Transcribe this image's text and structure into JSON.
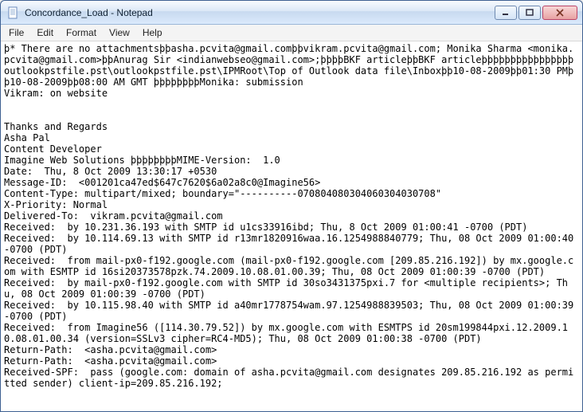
{
  "titlebar": {
    "title": "Concordance_Load - Notepad"
  },
  "menu": {
    "file": "File",
    "edit": "Edit",
    "format": "Format",
    "view": "View",
    "help": "Help"
  },
  "editor": {
    "content": "þ* There are no attachmentsþþasha.pcvita@gmail.comþþvikram.pcvita@gmail.com; Monika Sharma <monika.pcvita@gmail.com>þþAnurag Sir <indianwebseo@gmail.com>;þþþþBKF articleþþBKF articleþþþþþþþþþþþþþþþþoutlookpstfile.pst\\outlookpstfile.pst\\IPMRoot\\Top of Outlook data file\\Inboxþþ10-08-2009þþ01:30 PMþþ10-08-2009þþ08:00 AM GMT þþþþþþþþMonika: submission\nVikram: on website\n\n\nThanks and Regards\nAsha Pal\nContent Developer\nImagine Web Solutions þþþþþþþþMIME-Version:  1.0\nDate:  Thu, 8 Oct 2009 13:30:17 +0530\nMessage-ID:  <001201ca47ed$647c7620$6a02a8c0@Imagine56>\nContent-Type: multipart/mixed; boundary=\"----------070804080304060304030708\"\nX-Priority: Normal\nDelivered-To:  vikram.pcvita@gmail.com\nReceived:  by 10.231.36.193 with SMTP id u1cs33916ibd; Thu, 8 Oct 2009 01:00:41 -0700 (PDT)\nReceived:  by 10.114.69.13 with SMTP id r13mr1820916waa.16.1254988840779; Thu, 08 Oct 2009 01:00:40 -0700 (PDT)\nReceived:  from mail-px0-f192.google.com (mail-px0-f192.google.com [209.85.216.192]) by mx.google.com with ESMTP id 16si20373578pzk.74.2009.10.08.01.00.39; Thu, 08 Oct 2009 01:00:39 -0700 (PDT)\nReceived:  by mail-px0-f192.google.com with SMTP id 30so3431375pxi.7 for <multiple recipients>; Thu, 08 Oct 2009 01:00:39 -0700 (PDT)\nReceived:  by 10.115.98.40 with SMTP id a40mr1778754wam.97.1254988839503; Thu, 08 Oct 2009 01:00:39 -0700 (PDT)\nReceived:  from Imagine56 ([114.30.79.52]) by mx.google.com with ESMTPS id 20sm199844pxi.12.2009.10.08.01.00.34 (version=SSLv3 cipher=RC4-MD5); Thu, 08 Oct 2009 01:00:38 -0700 (PDT)\nReturn-Path:  <asha.pcvita@gmail.com>\nReturn-Path:  <asha.pcvita@gmail.com>\nReceived-SPF:  pass (google.com: domain of asha.pcvita@gmail.com designates 209.85.216.192 as permitted sender) client-ip=209.85.216.192;"
  }
}
